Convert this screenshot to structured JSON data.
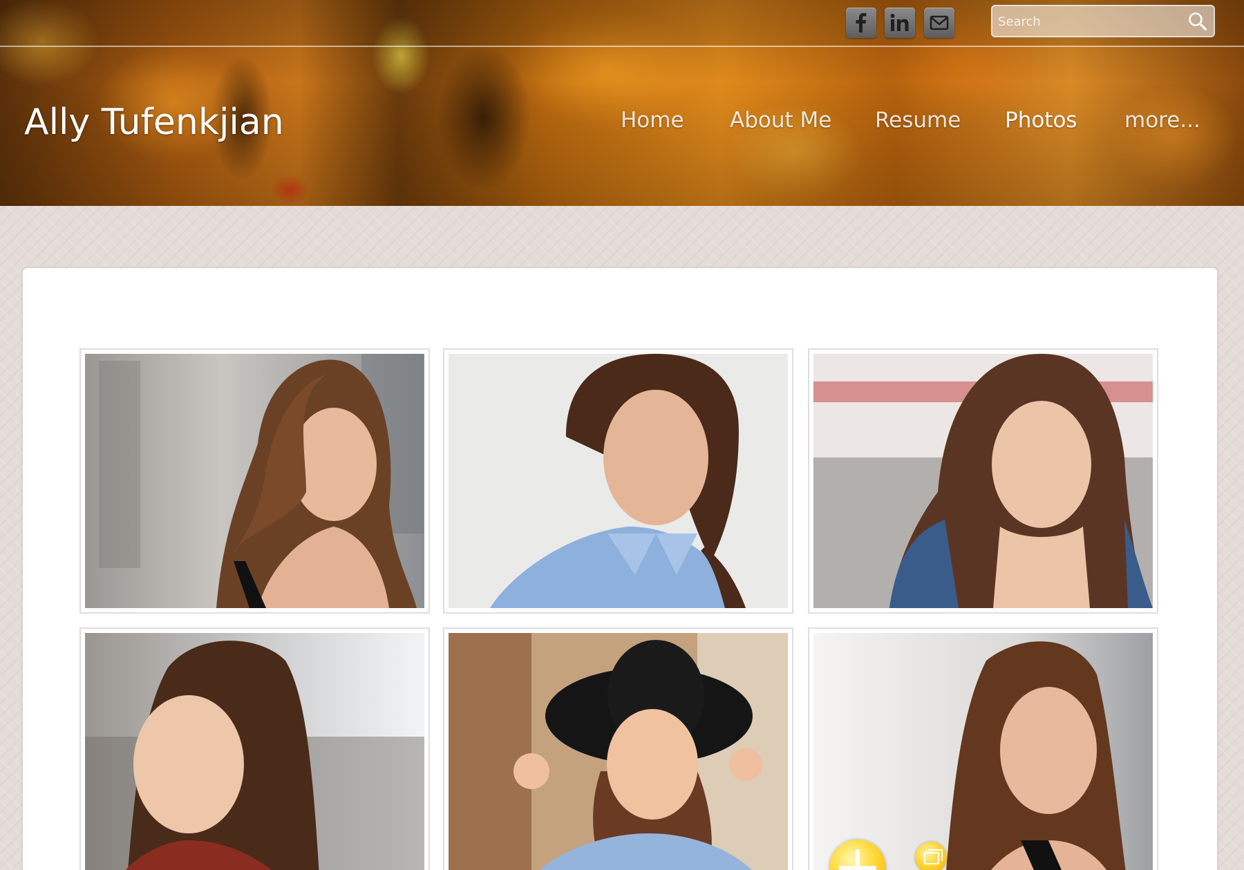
{
  "site": {
    "title": "Ally Tufenkjian"
  },
  "social": [
    {
      "name": "facebook",
      "icon": "facebook-icon",
      "label": "f"
    },
    {
      "name": "linkedin",
      "icon": "linkedin-icon",
      "label": "in"
    },
    {
      "name": "email",
      "icon": "mail-icon",
      "label": ""
    }
  ],
  "search": {
    "placeholder": "Search",
    "value": "",
    "icon": "search-icon"
  },
  "nav": {
    "items": [
      {
        "label": "Home",
        "active": false
      },
      {
        "label": "About Me",
        "active": false
      },
      {
        "label": "Resume",
        "active": false
      },
      {
        "label": "Photos",
        "active": true
      },
      {
        "label": "more..."
      }
    ]
  },
  "gallery": {
    "photos": [
      {
        "alt": "headshot-1"
      },
      {
        "alt": "headshot-2"
      },
      {
        "alt": "headshot-3"
      },
      {
        "alt": "headshot-4"
      },
      {
        "alt": "headshot-5"
      },
      {
        "alt": "headshot-6"
      }
    ]
  },
  "overlay_icons": [
    "add-plus-icon",
    "gallery-icon"
  ],
  "colors": {
    "nav_text": "#ffffff",
    "card_bg": "#ffffff",
    "page_bg": "#e4dcd8",
    "social_button": "#6e6e6e"
  }
}
